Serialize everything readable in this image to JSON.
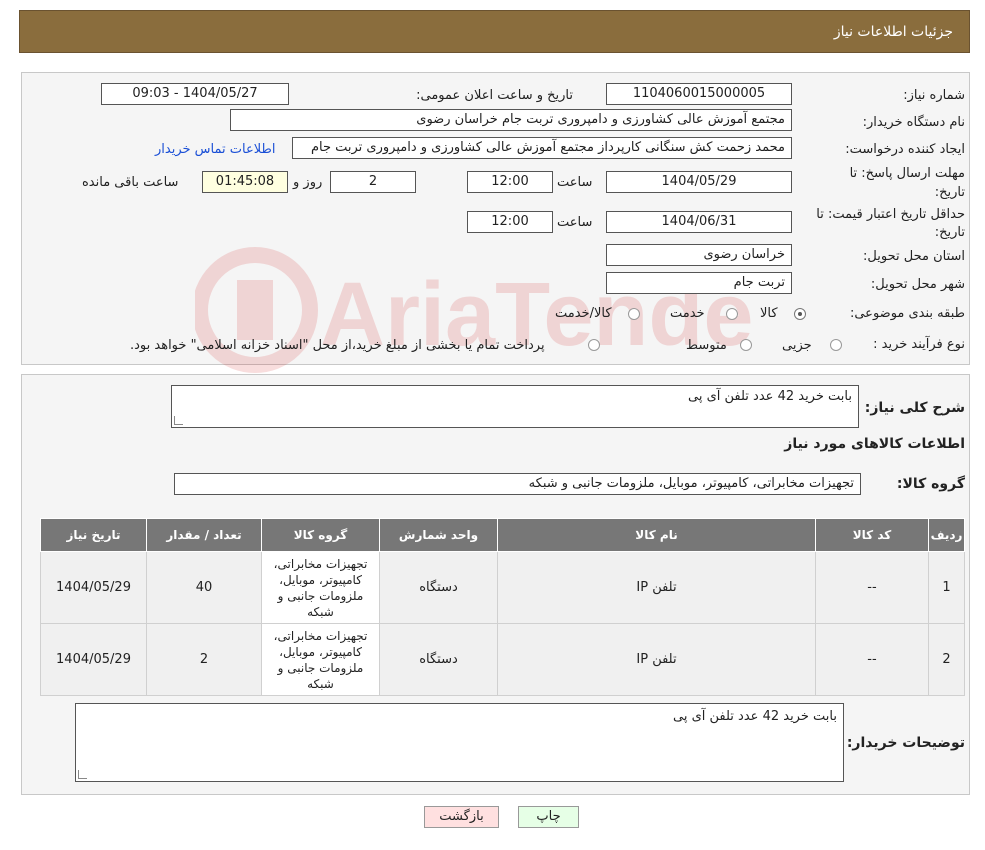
{
  "header": {
    "title": "جزئیات اطلاعات نیاز"
  },
  "form": {
    "need_number_label": "شماره نیاز:",
    "need_number": "1104060015000005",
    "announce_label": "تاریخ و ساعت اعلان عمومی:",
    "announce_value": "1404/05/27 - 09:03",
    "buyer_org_label": "نام دستگاه خریدار:",
    "buyer_org": "مجتمع آموزش عالی کشاورزی و دامپروری تربت جام خراسان رضوی",
    "requester_label": "ایجاد کننده درخواست:",
    "requester": "محمد زحمت کش سنگانی کارپرداز مجتمع آموزش عالی کشاورزی و دامپروری تربت جام",
    "contact_link": "اطلاعات تماس خریدار",
    "deadline_label_1": "مهلت ارسال پاسخ: تا",
    "deadline_label_2": "تاریخ:",
    "deadline_date": "1404/05/29",
    "time_label": "ساعت",
    "deadline_time": "12:00",
    "days_value": "2",
    "days_label": "روز و",
    "remaining_time": "01:45:08",
    "remaining_label": "ساعت باقی مانده",
    "validity_label_1": "حداقل تاریخ اعتبار قیمت: تا",
    "validity_label_2": "تاریخ:",
    "validity_date": "1404/06/31",
    "validity_time": "12:00",
    "province_label": "استان محل تحویل:",
    "province": "خراسان رضوی",
    "city_label": "شهر محل تحویل:",
    "city": "تربت جام",
    "category_label": "طبقه بندی موضوعی:",
    "category_options": [
      "کالا",
      "خدمت",
      "کالا/خدمت"
    ],
    "process_label": "نوع فرآیند خرید :",
    "process_options": [
      "جزیی",
      "متوسط"
    ],
    "process_note": "پرداخت تمام یا بخشی از مبلغ خرید،از محل \"اسناد خزانه اسلامی\" خواهد بود."
  },
  "summary": {
    "desc_label": "شرح کلی نیاز:",
    "desc_value": "بابت خرید 42 عدد تلفن آی پی",
    "goods_info_title": "اطلاعات کالاهای مورد نیاز",
    "group_label": "گروه کالا:",
    "group_value": "تجهیزات مخابراتی، کامپیوتر، موبایل، ملزومات جانبی و شبکه"
  },
  "table": {
    "headers": [
      "ردیف",
      "کد کالا",
      "نام کالا",
      "واحد شمارش",
      "گروه کالا",
      "تعداد / مقدار",
      "تاریخ نیاز"
    ],
    "rows": [
      [
        "1",
        "--",
        "تلفن IP",
        "دستگاه",
        "تجهیزات مخابراتی، کامپیوتر، موبایل، ملزومات جانبی و شبکه",
        "40",
        "1404/05/29"
      ],
      [
        "2",
        "--",
        "تلفن IP",
        "دستگاه",
        "تجهیزات مخابراتی، کامپیوتر، موبایل، ملزومات جانبی و شبکه",
        "2",
        "1404/05/29"
      ]
    ]
  },
  "buyer_notes": {
    "label": "توضیحات خریدار:",
    "value": "بابت خرید 42 عدد تلفن آی پی"
  },
  "buttons": {
    "print": "چاپ",
    "back": "بازگشت"
  },
  "colors": {
    "header_bg": "#8a6d3d",
    "back_button_bg": "#ffe0e0",
    "print_button_bg": "#e6ffe6"
  }
}
